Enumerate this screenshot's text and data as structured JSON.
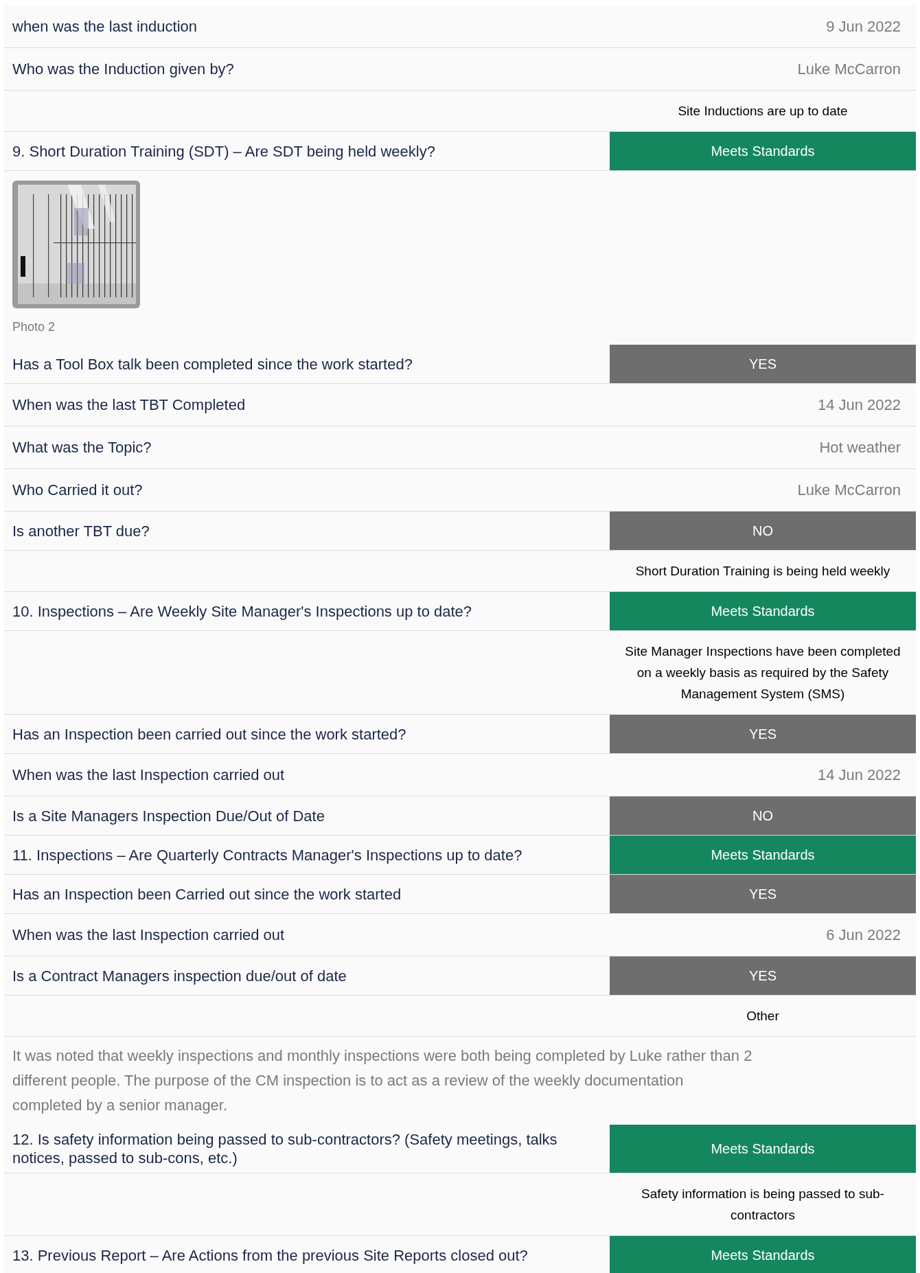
{
  "rows": [
    {
      "kind": "answer",
      "question": "when was the last induction",
      "value": "9 Jun 2022"
    },
    {
      "kind": "answer",
      "question": "Who was the Induction given by?",
      "value": "Luke McCarron"
    },
    {
      "kind": "comment",
      "text": "Site Inductions are up to date"
    },
    {
      "kind": "badge",
      "question": "9. Short Duration Training (SDT) – Are SDT being held weekly?",
      "value": "Meets Standards",
      "color": "#14875e"
    },
    {
      "caption": "Photo 2"
    },
    {
      "kind": "badge",
      "question": "Has a Tool Box talk been completed since the work started?",
      "value": "YES",
      "color": "#6e6e6e"
    },
    {
      "kind": "answer",
      "question": "When was the last TBT Completed",
      "value": "14 Jun 2022"
    },
    {
      "kind": "answer",
      "question": "What was the Topic?",
      "value": "Hot weather"
    },
    {
      "kind": "answer",
      "question": "Who Carried it out?",
      "value": "Luke McCarron"
    },
    {
      "kind": "badge",
      "question": "Is another TBT due?",
      "value": "NO",
      "color": "#6e6e6e"
    },
    {
      "kind": "comment",
      "text": "Short Duration Training is being held weekly"
    },
    {
      "kind": "badge",
      "question": "10. Inspections – Are Weekly Site Manager's Inspections up to date?",
      "value": "Meets Standards",
      "color": "#14875e"
    },
    {
      "kind": "comment",
      "text": "Site Manager Inspections have been completed on a weekly basis as required by the Safety Management System (SMS)"
    },
    {
      "kind": "badge",
      "question": "Has an Inspection been carried out since the work started?",
      "value": "YES",
      "color": "#6e6e6e"
    },
    {
      "kind": "answer",
      "question": "When was the last Inspection carried out",
      "value": "14 Jun 2022"
    },
    {
      "kind": "badge",
      "question": "Is a Site Managers Inspection Due/Out of Date",
      "value": "NO",
      "color": "#6e6e6e"
    },
    {
      "kind": "badge",
      "question": "11. Inspections – Are Quarterly Contracts Manager's Inspections up to date?",
      "value": "Meets Standards",
      "color": "#14875e"
    },
    {
      "kind": "badge",
      "question": "Has an Inspection been Carried out since the work started",
      "value": "YES",
      "color": "#6e6e6e"
    },
    {
      "kind": "answer",
      "question": "When was the last Inspection carried out",
      "value": "6 Jun 2022"
    },
    {
      "kind": "badge",
      "question": "Is a Contract Managers inspection due/out of date",
      "value": "YES",
      "color": "#6e6e6e"
    },
    {
      "kind": "comment",
      "text": "Other"
    },
    {
      "kind": "note",
      "text": "It was noted that weekly inspections and monthly inspections were both being completed by Luke rather than 2 different people. The purpose of the CM inspection is to act as a review of the weekly documentation completed by a senior manager."
    },
    {
      "kind": "badge",
      "question": "12. Is safety information being passed to sub-contractors? (Safety meetings, talks notices, passed to sub-cons, etc.)",
      "value": "Meets Standards",
      "color": "#14875e"
    },
    {
      "kind": "comment",
      "text": "Safety information is being passed to sub-contractors"
    },
    {
      "kind": "badge",
      "question": "13. Previous Report – Are Actions from the previous Site Reports closed out?",
      "value": "Meets Standards",
      "color": "#14875e"
    }
  ]
}
